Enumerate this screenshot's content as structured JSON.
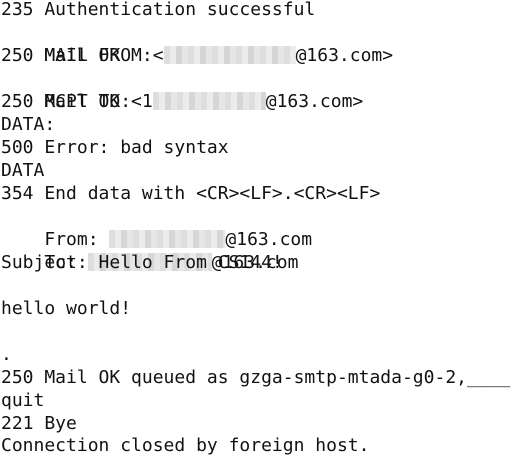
{
  "terminal": {
    "lines": {
      "auth": "235 Authentication successful",
      "mail_from_prefix": "MAIL FROM:<",
      "mail_from_suffix": "@163.com>",
      "mail_ok_1": "250 Mail OK",
      "rcpt_prefix": "RCPT TO:<1",
      "rcpt_suffix": "@163.com>",
      "mail_ok_2": "250 Mail OK",
      "data_colon": "DATA:",
      "error": "500 Error: bad syntax",
      "data": "DATA",
      "end_data": "354 End data with <CR><LF>.<CR><LF>",
      "from_prefix": "From: ",
      "from_suffix": "@163.com",
      "to_prefix": "To: ",
      "to_suffix": "@163.com",
      "subject": "Subject: Hello From CS144!",
      "body": "hello world!",
      "dot": ".",
      "queued": "250 Mail OK queued as gzga-smtp-mtada-g0-2,____",
      "quit": "quit",
      "bye": "221 Bye",
      "closed": "Connection closed by foreign host."
    }
  }
}
